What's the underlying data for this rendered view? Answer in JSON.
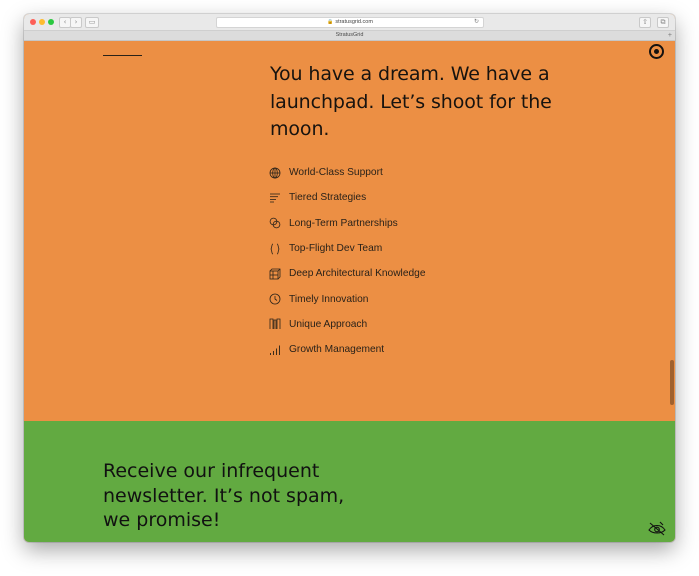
{
  "browser": {
    "url": "stratusgrid.com",
    "tab_title": "StratusGrid",
    "back_glyph": "‹",
    "forward_glyph": "›",
    "sidebar_glyph": "▭",
    "share_glyph": "⇧",
    "tabs_glyph": "⧉",
    "reload_glyph": "↻",
    "lock_glyph": "🔒",
    "new_tab_glyph": "+"
  },
  "hero": {
    "headline": "You have a dream. We have a launchpad. Let’s shoot for the moon.",
    "features": [
      {
        "label": "World-Class Support",
        "icon": "globe-icon"
      },
      {
        "label": "Tiered Strategies",
        "icon": "lines-icon"
      },
      {
        "label": "Long-Term Partnerships",
        "icon": "link-circles-icon"
      },
      {
        "label": "Top-Flight Dev Team",
        "icon": "braces-icon"
      },
      {
        "label": "Deep Architectural Knowledge",
        "icon": "cube-icon"
      },
      {
        "label": "Timely Innovation",
        "icon": "clock-icon"
      },
      {
        "label": "Unique Approach",
        "icon": "maze-icon"
      },
      {
        "label": "Growth Management",
        "icon": "bar-chart-icon"
      }
    ]
  },
  "newsletter": {
    "headline": "Receive our infrequent newsletter. It’s not spam, we promise!"
  },
  "colors": {
    "orange_section": "#ec8f44",
    "green_section": "#62aa41",
    "ink": "#17130f"
  }
}
